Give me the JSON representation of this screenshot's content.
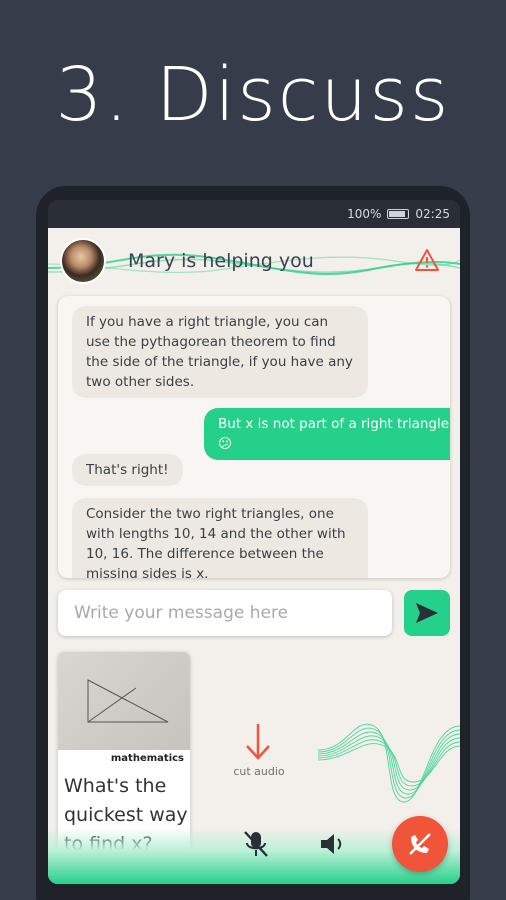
{
  "headline": "3. Discuss",
  "statusbar": {
    "battery": "100%",
    "time": "02:25"
  },
  "header": {
    "title": "Mary is helping you"
  },
  "messages": [
    {
      "from": "tutor",
      "text": "If you have a right triangle, you can use the pythagorean theorem to find the side of the triangle, if you have any two other sides."
    },
    {
      "from": "student",
      "text": "But x is not part of a right triangle 😕"
    },
    {
      "from": "tutor",
      "text": "That's right!"
    },
    {
      "from": "tutor",
      "text": "Consider the two right triangles, one with lengths 10, 14 and the other with 10, 16. The difference between the missing sides is x."
    }
  ],
  "composer": {
    "placeholder": "Write your message here"
  },
  "question_card": {
    "subject": "mathematics",
    "question": "What's the quickest way to find x?"
  },
  "controls": {
    "cut_audio_label": "cut audio"
  },
  "colors": {
    "accent": "#25d08a",
    "danger": "#f0553a",
    "background": "#353d4b"
  },
  "icons": [
    "warning-icon",
    "send-icon",
    "arrow-down-icon",
    "mic-off-icon",
    "speaker-icon",
    "hangup-icon"
  ]
}
